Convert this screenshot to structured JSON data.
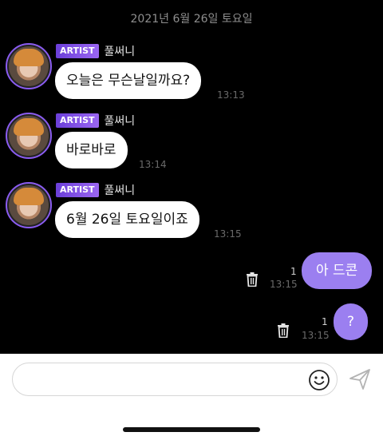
{
  "date_label": "2021년 6월 26일 토요일",
  "incoming": [
    {
      "badge": "ARTIST",
      "name": "풀써니",
      "text": "오늘은 무슨날일까요?",
      "time": "13:13"
    },
    {
      "badge": "ARTIST",
      "name": "풀써니",
      "text": "바로바로",
      "time": "13:14"
    },
    {
      "badge": "ARTIST",
      "name": "풀써니",
      "text": "6월 26일 토요일이죠",
      "time": "13:15"
    }
  ],
  "outgoing": [
    {
      "text": "아 드콘",
      "count": "1",
      "time": "13:15"
    },
    {
      "text": "?",
      "count": "1",
      "time": "13:15"
    }
  ],
  "composer": {
    "placeholder": ""
  },
  "colors": {
    "badge": "#7c4ee4",
    "outgoing_bubble": "#9b7ff0",
    "background": "#000000"
  }
}
